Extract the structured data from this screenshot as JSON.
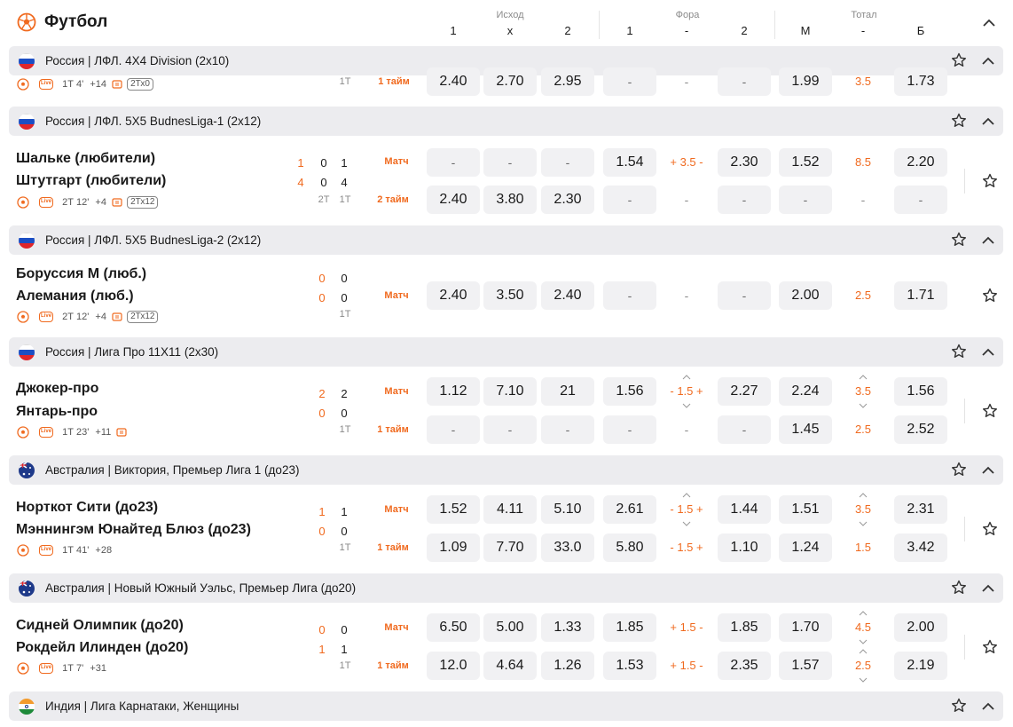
{
  "header": {
    "title": "Футбол",
    "groups": [
      "Исход",
      "Фора",
      "Тотал"
    ],
    "columns": [
      "1",
      "x",
      "2",
      "1",
      "-",
      "2",
      "М",
      "-",
      "Б"
    ]
  },
  "leagues": [
    {
      "country": "russia",
      "name": "Россия | ЛФЛ. 4X4 Division (2x10)"
    },
    {
      "country": "russia",
      "name": "Россия | ЛФЛ. 5X5 BudnesLiga-1 (2x12)"
    },
    {
      "country": "russia",
      "name": "Россия | ЛФЛ. 5X5 BudnesLiga-2 (2x12)"
    },
    {
      "country": "russia",
      "name": "Россия | Лига Про 11X11 (2x30)"
    },
    {
      "country": "australia",
      "name": "Австралия | Виктория, Премьер Лига 1 (до23)"
    },
    {
      "country": "australia",
      "name": "Австралия | Новый Южный Уэльс, Премьер Лига (до20)"
    },
    {
      "country": "india",
      "name": "Индия | Лига Карнатаки, Женщины"
    }
  ],
  "matches": {
    "m0": {
      "info": {
        "live": "Live",
        "time": "1Т 4'",
        "more": "+14",
        "tx": "2Тх0"
      },
      "period": "1Т",
      "row": {
        "label": "1 тайм",
        "vals": [
          "2.40",
          "2.70",
          "2.95",
          "-",
          "-",
          "-",
          "1.99",
          "3.5",
          "1.73"
        ]
      }
    },
    "m1": {
      "team1": "Шальке (любители)",
      "team2": "Штутгарт (любители)",
      "s1": [
        "1",
        "0",
        "1"
      ],
      "s2": [
        "4",
        "0",
        "4"
      ],
      "p": [
        "2Т",
        "1Т"
      ],
      "info": {
        "live": "Live",
        "time": "2Т 12'",
        "more": "+4",
        "tx": "2Тх12"
      },
      "rows": [
        {
          "label": "Матч",
          "vals": [
            "-",
            "-",
            "-",
            "1.54",
            "+ 3.5 -",
            "2.30",
            "1.52",
            "8.5",
            "2.20"
          ]
        },
        {
          "label": "2 тайм",
          "vals": [
            "2.40",
            "3.80",
            "2.30",
            "-",
            "-",
            "-",
            "-",
            "-",
            "-"
          ]
        }
      ]
    },
    "m2": {
      "team1": "Боруссия М (люб.)",
      "team2": "Алемания (люб.)",
      "s1": [
        "0",
        "0"
      ],
      "s2": [
        "0",
        "0"
      ],
      "p": [
        "1Т"
      ],
      "info": {
        "live": "Live",
        "time": "2Т 12'",
        "more": "+4",
        "tx": "2Тх12"
      },
      "rows": [
        {
          "label": "Матч",
          "vals": [
            "2.40",
            "3.50",
            "2.40",
            "-",
            "-",
            "-",
            "2.00",
            "2.5",
            "1.71"
          ]
        }
      ]
    },
    "m3": {
      "team1": "Джокер-про",
      "team2": "Янтарь-про",
      "s1": [
        "2",
        "2"
      ],
      "s2": [
        "0",
        "0"
      ],
      "p": [
        "1Т"
      ],
      "info": {
        "live": "Live",
        "time": "1Т 23'",
        "more": "+11"
      },
      "rows": [
        {
          "label": "Матч",
          "vals": [
            "1.12",
            "7.10",
            "21",
            "1.56",
            "- 1.5 +",
            "2.27",
            "2.24",
            "3.5",
            "1.56"
          ]
        },
        {
          "label": "1 тайм",
          "vals": [
            "-",
            "-",
            "-",
            "-",
            "-",
            "-",
            "1.45",
            "2.5",
            "2.52"
          ]
        }
      ]
    },
    "m4": {
      "team1": "Норткот Сити (до23)",
      "team2": "Мэннингэм Юнайтед Блюз (до23)",
      "s1": [
        "1",
        "1"
      ],
      "s2": [
        "0",
        "0"
      ],
      "p": [
        "1Т"
      ],
      "info": {
        "live": "Live",
        "time": "1Т 41'",
        "more": "+28"
      },
      "rows": [
        {
          "label": "Матч",
          "vals": [
            "1.52",
            "4.11",
            "5.10",
            "2.61",
            "- 1.5 +",
            "1.44",
            "1.51",
            "3.5",
            "2.31"
          ]
        },
        {
          "label": "1 тайм",
          "vals": [
            "1.09",
            "7.70",
            "33.0",
            "5.80",
            "- 1.5 +",
            "1.10",
            "1.24",
            "1.5",
            "3.42"
          ]
        }
      ]
    },
    "m5": {
      "team1": "Сидней Олимпик (до20)",
      "team2": "Рокдейл Илинден (до20)",
      "s1": [
        "0",
        "0"
      ],
      "s2": [
        "1",
        "1"
      ],
      "p": [
        "1Т"
      ],
      "info": {
        "live": "Live",
        "time": "1Т 7'",
        "more": "+31"
      },
      "rows": [
        {
          "label": "Матч",
          "vals": [
            "6.50",
            "5.00",
            "1.33",
            "1.85",
            "+ 1.5 -",
            "1.85",
            "1.70",
            "4.5",
            "2.00"
          ]
        },
        {
          "label": "1 тайм",
          "vals": [
            "12.0",
            "4.64",
            "1.26",
            "1.53",
            "+ 1.5 -",
            "2.35",
            "1.57",
            "2.5",
            "2.19"
          ]
        }
      ]
    }
  }
}
